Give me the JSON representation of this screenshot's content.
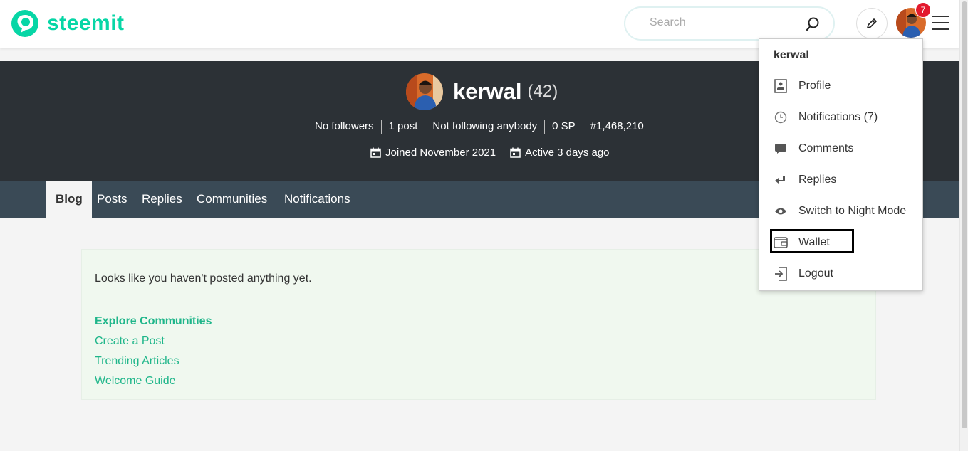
{
  "header": {
    "brand": "steemit",
    "search_placeholder": "Search",
    "notification_count": "7"
  },
  "profile": {
    "name": "kerwal",
    "reputation": "(42)",
    "stats": [
      "No followers",
      "1 post",
      "Not following anybody",
      "0 SP",
      "#1,468,210"
    ],
    "joined": "Joined November 2021",
    "active": "Active 3 days ago"
  },
  "tabs": [
    "Blog",
    "Posts",
    "Replies",
    "Communities",
    "Notifications"
  ],
  "content": {
    "empty_message": "Looks like you haven't posted anything yet.",
    "links": [
      "Explore Communities",
      "Create a Post",
      "Trending Articles",
      "Welcome Guide"
    ]
  },
  "dropdown": {
    "username": "kerwal",
    "items": [
      {
        "label": "Profile",
        "icon": "profile-icon"
      },
      {
        "label": "Notifications (7)",
        "icon": "clock-icon"
      },
      {
        "label": "Comments",
        "icon": "comment-icon"
      },
      {
        "label": "Replies",
        "icon": "reply-icon"
      },
      {
        "label": "Switch to Night Mode",
        "icon": "eye-icon"
      },
      {
        "label": "Wallet",
        "icon": "wallet-icon"
      },
      {
        "label": "Logout",
        "icon": "logout-icon"
      }
    ]
  },
  "colors": {
    "brand": "#07d6a6",
    "link": "#1fb68a",
    "banner": "#2c3136",
    "tabbar": "#3a4a56",
    "badge": "#e3192d"
  }
}
